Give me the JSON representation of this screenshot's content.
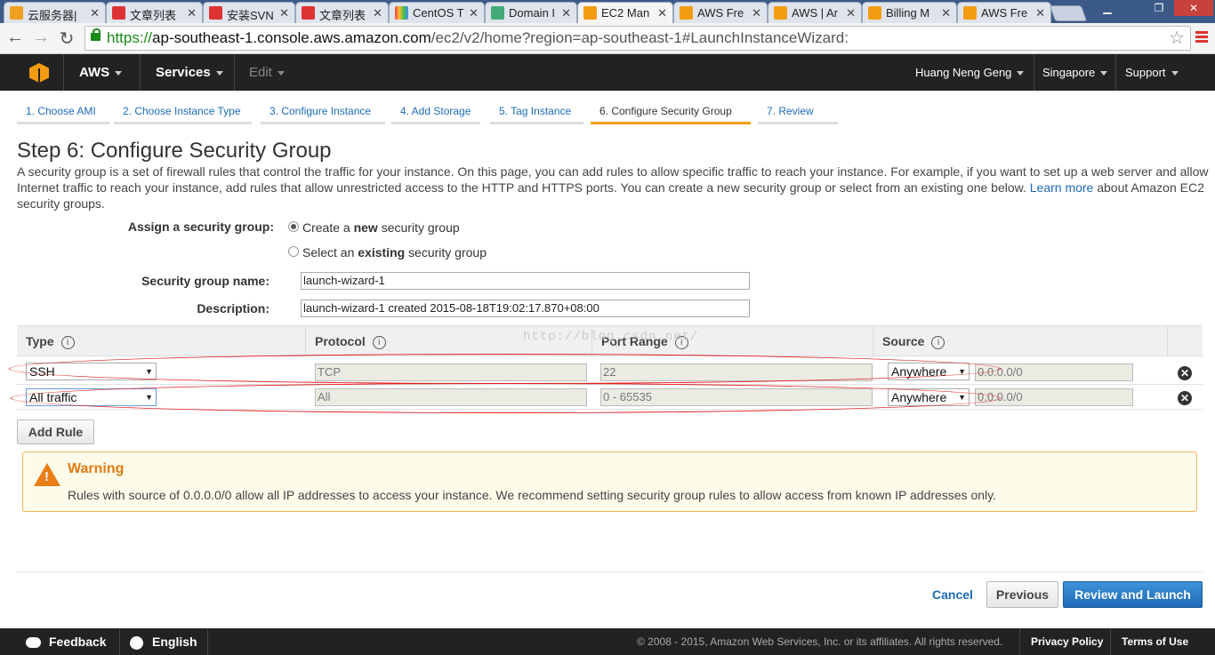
{
  "browser": {
    "tabs": [
      {
        "label": "云服务器|",
        "color": "#f0a020"
      },
      {
        "label": "文章列表",
        "color": "#d33"
      },
      {
        "label": "安装SVN",
        "color": "#d33"
      },
      {
        "label": "文章列表",
        "color": "#d33"
      },
      {
        "label": "CentOS T",
        "color": "#7a4"
      },
      {
        "label": "Domain I",
        "color": "#4a7"
      },
      {
        "label": "EC2 Man",
        "color": "#f39c12"
      },
      {
        "label": "AWS Fre",
        "color": "#f39c12"
      },
      {
        "label": "AWS | Ar",
        "color": "#f39c12"
      },
      {
        "label": "Billing M",
        "color": "#f39c12"
      },
      {
        "label": "AWS Fre",
        "color": "#f39c12"
      }
    ],
    "url_scheme": "https://",
    "url_host": "ap-southeast-1.console.aws.amazon.com",
    "url_path": "/ec2/v2/home?region=ap-southeast-1#LaunchInstanceWizard:"
  },
  "awsnav": {
    "brand": "AWS",
    "services": "Services",
    "edit": "Edit",
    "user": "Huang Neng Geng",
    "region": "Singapore",
    "support": "Support"
  },
  "wizard": {
    "steps": [
      "1. Choose AMI",
      "2. Choose Instance Type",
      "3. Configure Instance",
      "4. Add Storage",
      "5. Tag Instance",
      "6. Configure Security Group",
      "7. Review"
    ],
    "title": "Step 6: Configure Security Group",
    "intro": "A security group is a set of firewall rules that control the traffic for your instance. On this page, you can add rules to allow specific traffic to reach your instance. For example, if you want to set up a web server and allow Internet traffic to reach your instance, add rules that allow unrestricted access to the HTTP and HTTPS ports. You can create a new security group or select from an existing one below.",
    "learn_more": "Learn more",
    "intro_tail": "about Amazon EC2 security groups."
  },
  "form": {
    "assign_label": "Assign a security group:",
    "opt_create_pre": "Create a ",
    "opt_create_bold": "new",
    "opt_create_post": " security group",
    "opt_select_pre": "Select an ",
    "opt_select_bold": "existing",
    "opt_select_post": " security group",
    "name_label": "Security group name:",
    "name_value": "launch-wizard-1",
    "desc_label": "Description:",
    "desc_value": "launch-wizard-1 created 2015-08-18T19:02:17.870+08:00"
  },
  "rules": {
    "headers": {
      "type": "Type",
      "protocol": "Protocol",
      "port": "Port Range",
      "source": "Source"
    },
    "rows": [
      {
        "type": "SSH",
        "protocol": "TCP",
        "port": "22",
        "source": "Anywhere",
        "cidr": "0.0.0.0/0"
      },
      {
        "type": "All traffic",
        "protocol": "All",
        "port": "0 - 65535",
        "source": "Anywhere",
        "cidr": "0.0.0.0/0"
      }
    ],
    "add_rule": "Add Rule",
    "watermark": "http://blog.csdn.net/"
  },
  "warning": {
    "title": "Warning",
    "body": "Rules with source of 0.0.0.0/0 allow all IP addresses to access your instance. We recommend setting security group rules to allow access from known IP addresses only."
  },
  "actions": {
    "cancel": "Cancel",
    "previous": "Previous",
    "review": "Review and Launch"
  },
  "footer": {
    "feedback": "Feedback",
    "language": "English",
    "copyright": "© 2008 - 2015, Amazon Web Services, Inc. or its affiliates. All rights reserved.",
    "privacy": "Privacy Policy",
    "terms": "Terms of Use"
  }
}
